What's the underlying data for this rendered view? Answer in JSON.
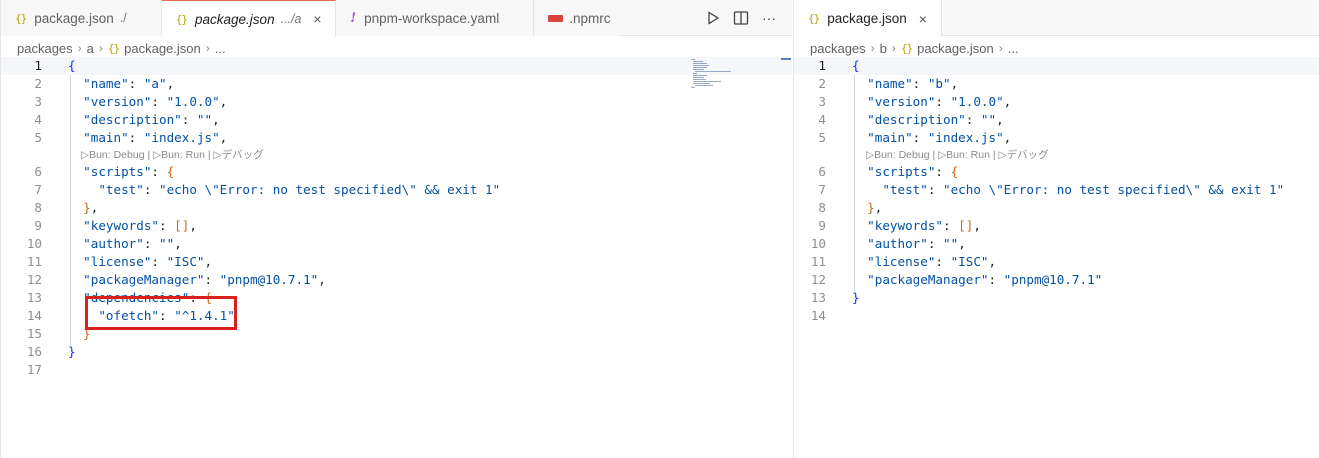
{
  "left_pane": {
    "tabs": [
      {
        "name": "package.json",
        "desc": "./"
      },
      {
        "name": "package.json",
        "desc": ".../a"
      },
      {
        "name": "pnpm-workspace.yaml"
      },
      {
        "name": ".npmrc"
      }
    ],
    "breadcrumb": [
      "packages",
      "a",
      "package.json",
      "..."
    ],
    "code_lens": "▷Bun: Debug | ▷Bun: Run | ▷デバッグ",
    "lines": [
      {
        "n": "1",
        "t": "{"
      },
      {
        "n": "2",
        "t": "  \"name\": \"a\","
      },
      {
        "n": "3",
        "t": "  \"version\": \"1.0.0\","
      },
      {
        "n": "4",
        "t": "  \"description\": \"\","
      },
      {
        "n": "5",
        "t": "  \"main\": \"index.js\","
      },
      {
        "n": "6",
        "t": "  \"scripts\": {"
      },
      {
        "n": "7",
        "t": "    \"test\": \"echo \\\"Error: no test specified\\\" && exit 1\""
      },
      {
        "n": "8",
        "t": "  },"
      },
      {
        "n": "9",
        "t": "  \"keywords\": [],"
      },
      {
        "n": "10",
        "t": "  \"author\": \"\","
      },
      {
        "n": "11",
        "t": "  \"license\": \"ISC\","
      },
      {
        "n": "12",
        "t": "  \"packageManager\": \"pnpm@10.7.1\","
      },
      {
        "n": "13",
        "t": "  \"dependencies\": {"
      },
      {
        "n": "14",
        "t": "    \"ofetch\": \"^1.4.1\""
      },
      {
        "n": "15",
        "t": "  }"
      },
      {
        "n": "16",
        "t": "}"
      },
      {
        "n": "17",
        "t": ""
      }
    ]
  },
  "right_pane": {
    "tabs": [
      {
        "name": "package.json"
      }
    ],
    "breadcrumb": [
      "packages",
      "b",
      "package.json",
      "..."
    ],
    "code_lens": "▷Bun: Debug | ▷Bun: Run | ▷デバッグ",
    "lines": [
      {
        "n": "1",
        "t": "{"
      },
      {
        "n": "2",
        "t": "  \"name\": \"b\","
      },
      {
        "n": "3",
        "t": "  \"version\": \"1.0.0\","
      },
      {
        "n": "4",
        "t": "  \"description\": \"\","
      },
      {
        "n": "5",
        "t": "  \"main\": \"index.js\","
      },
      {
        "n": "6",
        "t": "  \"scripts\": {"
      },
      {
        "n": "7",
        "t": "    \"test\": \"echo \\\"Error: no test specified\\\" && exit 1\""
      },
      {
        "n": "8",
        "t": "  },"
      },
      {
        "n": "9",
        "t": "  \"keywords\": [],"
      },
      {
        "n": "10",
        "t": "  \"author\": \"\","
      },
      {
        "n": "11",
        "t": "  \"license\": \"ISC\","
      },
      {
        "n": "12",
        "t": "  \"packageManager\": \"pnpm@10.7.1\""
      },
      {
        "n": "13",
        "t": "}"
      },
      {
        "n": "14",
        "t": ""
      }
    ]
  },
  "icons": {
    "json": "{}",
    "yaml": "!",
    "close": "×",
    "run": "▷",
    "split": "split-editor-icon",
    "more": "···"
  },
  "colors": {
    "active_tab_border": "#e36c48",
    "highlight_box": "#d9211c",
    "json_key": "#0451a5"
  }
}
